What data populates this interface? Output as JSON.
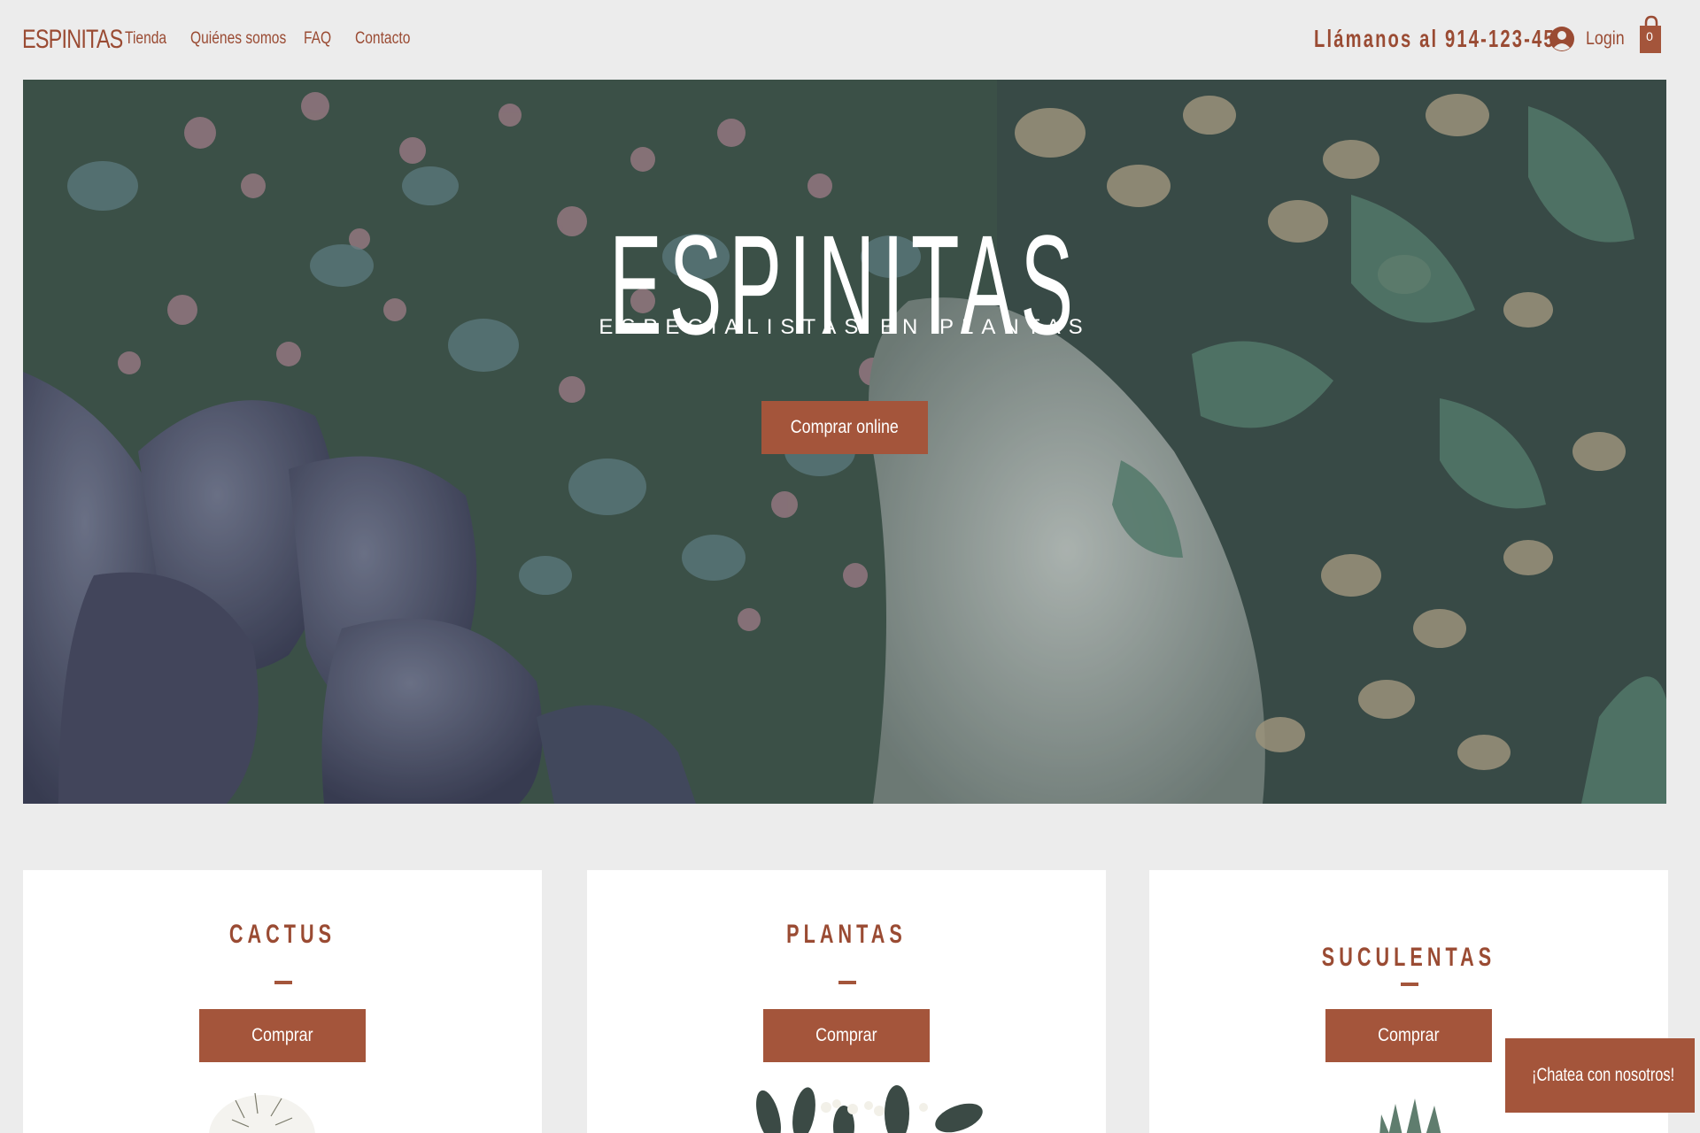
{
  "header": {
    "logo": "ESPINITAS",
    "nav": [
      "Tienda",
      "Quiénes somos",
      "FAQ",
      "Contacto"
    ],
    "phone": "Llámanos al 914-123-456",
    "login_label": "Login",
    "cart_count": "0"
  },
  "hero": {
    "title": "ESPINITAS",
    "subtitle": "ESPECIALISTAS EN PLANTAS",
    "cta": "Comprar online"
  },
  "cards": [
    {
      "title": "CACTUS",
      "button": "Comprar"
    },
    {
      "title": "PLANTAS",
      "button": "Comprar"
    },
    {
      "title": "SUCULENTAS",
      "button": "Comprar"
    }
  ],
  "chat": {
    "label": "¡Chatea con nosotros!"
  },
  "colors": {
    "brand": "#9a4b33",
    "button": "#a4553b",
    "page_bg": "#ececec"
  }
}
